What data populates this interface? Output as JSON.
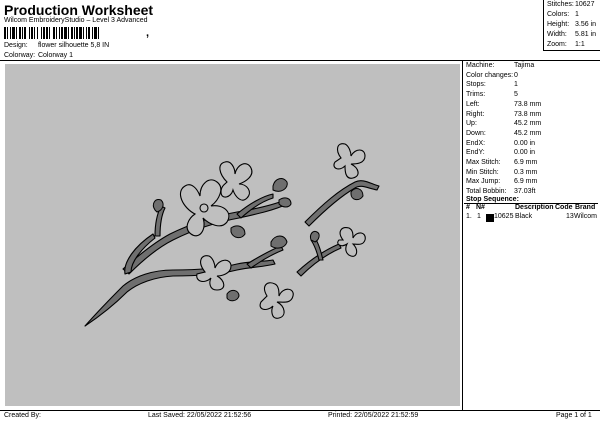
{
  "header": {
    "title": "Production Worksheet",
    "subtitle": "Wilcom EmbroideryStudio – Level 3 Advanced",
    "barcode_suffix": ","
  },
  "meta": {
    "design_label": "Design:",
    "design_value": "flower silhouette 5,8 IN",
    "colorway_label": "Colorway:",
    "colorway_value": "Colorway 1"
  },
  "stats": [
    {
      "label": "Stitches:",
      "value": "10627"
    },
    {
      "label": "Colors:",
      "value": "1"
    },
    {
      "label": "Height:",
      "value": "3.56 in"
    },
    {
      "label": "Width:",
      "value": "5.81 in"
    },
    {
      "label": "Zoom:",
      "value": "1:1"
    }
  ],
  "info": [
    {
      "label": "Machine:",
      "value": "Tajima"
    },
    {
      "label": "Color changes:",
      "value": "0"
    },
    {
      "label": "Stops:",
      "value": "1"
    },
    {
      "label": "Trims:",
      "value": "5"
    },
    {
      "label": "Left:",
      "value": "73.8 mm"
    },
    {
      "label": "Right:",
      "value": "73.8 mm"
    },
    {
      "label": "Up:",
      "value": "45.2 mm"
    },
    {
      "label": "Down:",
      "value": "45.2 mm"
    },
    {
      "label": "EndX:",
      "value": "0.00 in"
    },
    {
      "label": "EndY:",
      "value": "0.00 in"
    },
    {
      "label": "Max Stitch:",
      "value": "6.9 mm"
    },
    {
      "label": "Min Stitch:",
      "value": "0.3 mm"
    },
    {
      "label": "Max Jump:",
      "value": "6.9 mm"
    },
    {
      "label": "Total Bobbin:",
      "value": "37.03ft"
    }
  ],
  "stop_sequence": {
    "title": "Stop Sequence:",
    "headers": [
      "#",
      "N#",
      "",
      "Description",
      "Code",
      "Brand"
    ],
    "rows": [
      {
        "num": "1.",
        "needle": "1",
        "swatch_color": "#000000",
        "stitches": "10625",
        "description": "Black",
        "code": "13",
        "brand": "Wilcom"
      }
    ]
  },
  "footer": {
    "created_by": "Created By:",
    "last_saved": "Last Saved: 22/05/2022 21:52:56",
    "printed": "Printed: 22/05/2022 21:52:59",
    "page": "Page 1 of 1"
  },
  "colors": {
    "canvas": "#bfbfbf",
    "thread": "#000000",
    "fill": "#6f6f6f"
  }
}
